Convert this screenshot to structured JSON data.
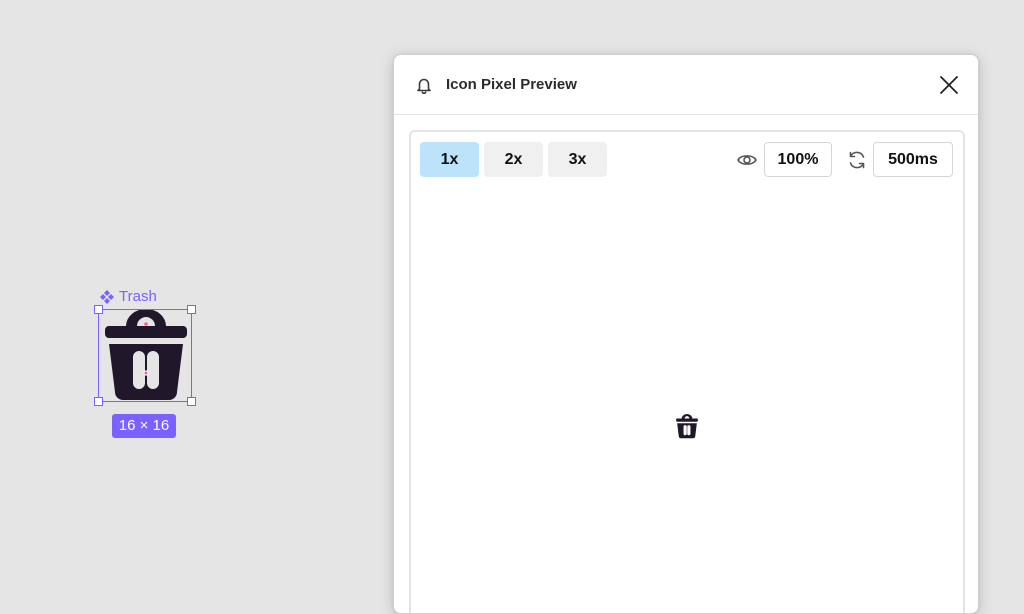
{
  "canvas": {
    "component_name": "Trash",
    "size_label": "16 × 16",
    "accent_color": "#7b61ff",
    "icon": "trash-icon",
    "icon_color": "#20172a"
  },
  "panel": {
    "title": "Icon Pixel Preview",
    "title_icon": "bell-icon",
    "close_icon": "close-icon",
    "toolbar": {
      "scales": [
        "1x",
        "2x",
        "3x"
      ],
      "active_scale": "1x",
      "active_color": "#bde3fb",
      "opacity_icon": "eye-icon",
      "opacity": "100%",
      "interval_icon": "refresh-icon",
      "interval": "500ms"
    },
    "preview_icon": "trash-icon"
  }
}
